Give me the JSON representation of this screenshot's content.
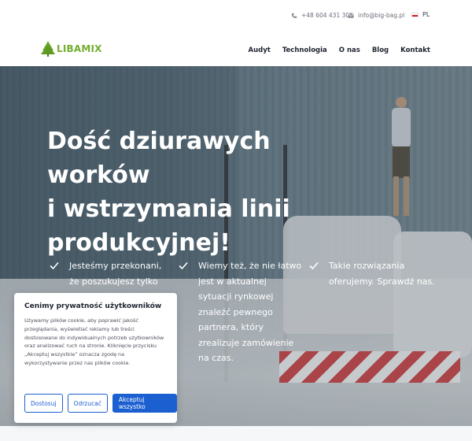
{
  "topbar": {
    "phone": "+48 604 431 309",
    "email": "info@big-bag.pl",
    "language": "PL",
    "icons": {
      "phone": "phone-icon",
      "email": "envelope-icon",
      "flag": "poland-flag-icon"
    }
  },
  "header": {
    "logo_text": "LIBAMIX",
    "nav": [
      {
        "label": "Audyt"
      },
      {
        "label": "Technologia"
      },
      {
        "label": "O nas"
      },
      {
        "label": "Blog"
      },
      {
        "label": "Kontakt"
      }
    ]
  },
  "hero": {
    "headline_lines": [
      "Dość dziurawych worków",
      "i wstrzymania linii",
      "produkcyjnej!"
    ],
    "features": [
      {
        "text": "Jesteśmy przekonani, że poszukujesz tylko"
      },
      {
        "text": "Wiemy też, że nie łatwo jest w aktualnej sytuacji rynkowej znaleźć pewnego partnera, który zrealizuje zamówienie na czas."
      },
      {
        "text": "Takie rozwiązania oferujemy. Sprawdź nas."
      }
    ]
  },
  "cookie": {
    "title": "Cenimy prywatność użytkowników",
    "body": "Używamy plików cookie, aby poprawić jakość przeglądania, wyświetlać reklamy lub treści dostosowane do indywidualnych potrzeb użytkowników oraz analizować ruch na stronie. Kliknięcie przycisku „Akceptuj wszystkie” oznacza zgodę na wykorzystywanie przez nas plików cookie.",
    "customize_label": "Dostosuj",
    "reject_label": "Odrzucać",
    "accept_label": "Akceptuj wszystko"
  },
  "colors": {
    "brand_green": "#74ad2f",
    "accent_blue": "#1b5fd0",
    "nav_text": "#1f2430"
  }
}
